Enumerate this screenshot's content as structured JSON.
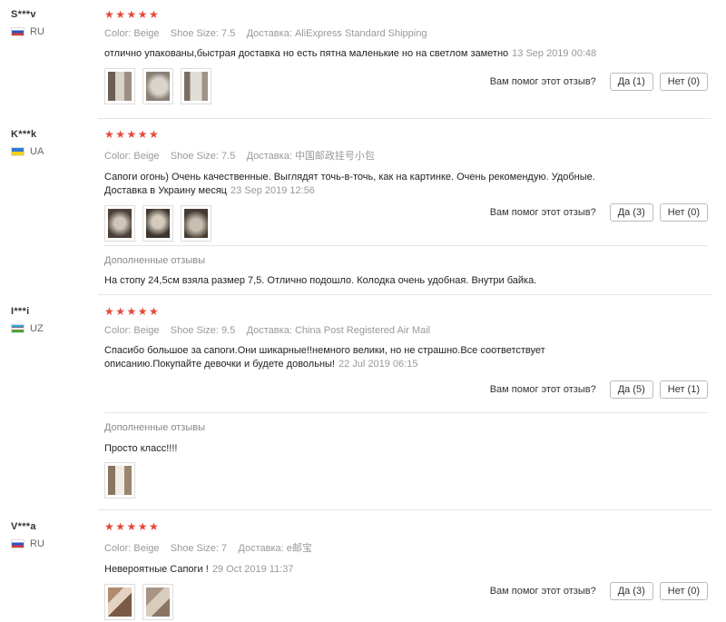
{
  "labels": {
    "color": "Color:",
    "shoe_size": "Shoe Size:",
    "delivery": "Доставка:",
    "helpful": "Вам помог этот отзыв?",
    "additional": "Дополненные отзывы",
    "stars": "★★★★★"
  },
  "reviews": [
    {
      "user": "S***v",
      "country": "RU",
      "color": "Beige",
      "size": "7.5",
      "delivery": "AliExpress Standard Shipping",
      "text": "отлично упакованы,быстрая доставка но есть пятна маленькие но на светлом заметно",
      "date": "13 Sep 2019 00:48",
      "yes": "Да (1)",
      "no": "Нет (0)"
    },
    {
      "user": "K***k",
      "country": "UA",
      "color": "Beige",
      "size": "7.5",
      "delivery": "中国邮政挂号小包",
      "text": "Сапоги огонь) Очень качественные. Выглядят точь-в-точь, как на картинке. Очень рекомендую. Удобные. Доставка в Украину месяц",
      "date": "23 Sep 2019 12:56",
      "yes": "Да (3)",
      "no": "Нет (0)",
      "additional": "На стопу 24,5см взяла размер 7,5. Отлично подошло. Колодка очень удобная. Внутри байка."
    },
    {
      "user": "I***i",
      "country": "UZ",
      "color": "Beige",
      "size": "9.5",
      "delivery": "China Post Registered Air Mail",
      "text": "Спасибо большое за сапоги.Они шикарные!!немного велики, но не страшно.Все соответствует описанию.Покупайте девочки и будете довольны!",
      "date": "22 Jul 2019 06:15",
      "yes": "Да (5)",
      "no": "Нет (1)",
      "additional": "Просто класс!!!!"
    },
    {
      "user": "V***a",
      "country": "RU",
      "color": "Beige",
      "size": "7",
      "delivery": "e邮宝",
      "text": "Невероятные Сапоги !",
      "date": "29 Oct 2019 11:37",
      "yes": "Да (3)",
      "no": "Нет (0)"
    }
  ]
}
